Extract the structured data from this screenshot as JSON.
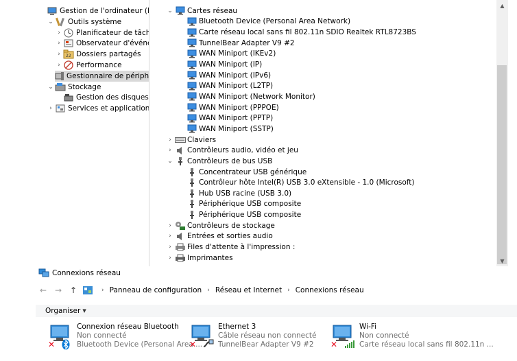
{
  "left_tree": [
    {
      "label": "Gestion de l'ordinateur (local)",
      "icon": "computer-management-icon",
      "chevron": "",
      "indent": 0,
      "selected": false
    },
    {
      "label": "Outils système",
      "icon": "system-tools-icon",
      "chevron": "down",
      "indent": 1,
      "selected": false
    },
    {
      "label": "Planificateur de tâches",
      "icon": "clock-icon",
      "chevron": "right",
      "indent": 2,
      "selected": false
    },
    {
      "label": "Observateur d'événeme",
      "icon": "event-viewer-icon",
      "chevron": "right",
      "indent": 2,
      "selected": false
    },
    {
      "label": "Dossiers partagés",
      "icon": "shared-folder-icon",
      "chevron": "right",
      "indent": 2,
      "selected": false
    },
    {
      "label": "Performance",
      "icon": "performance-icon",
      "chevron": "right",
      "indent": 2,
      "selected": false
    },
    {
      "label": "Gestionnaire de périphé",
      "icon": "device-manager-icon",
      "chevron": "",
      "indent": 2,
      "selected": true
    },
    {
      "label": "Stockage",
      "icon": "storage-icon",
      "chevron": "down",
      "indent": 1,
      "selected": false
    },
    {
      "label": "Gestion des disques",
      "icon": "disk-management-icon",
      "chevron": "",
      "indent": 2,
      "selected": false
    },
    {
      "label": "Services et applications",
      "icon": "services-icon",
      "chevron": "right",
      "indent": 1,
      "selected": false
    }
  ],
  "device_tree": [
    {
      "label": "Cartes réseau",
      "icon": "network-adapter-icon",
      "chevron": "down",
      "indent": 0
    },
    {
      "label": "Bluetooth Device (Personal Area Network)",
      "icon": "network-adapter-icon",
      "chevron": "",
      "indent": 1
    },
    {
      "label": "Carte réseau local sans fil 802.11n SDIO Realtek RTL8723BS",
      "icon": "network-adapter-icon",
      "chevron": "",
      "indent": 1
    },
    {
      "label": "TunnelBear Adapter V9 #2",
      "icon": "network-adapter-icon",
      "chevron": "",
      "indent": 1
    },
    {
      "label": "WAN Miniport (IKEv2)",
      "icon": "network-adapter-icon",
      "chevron": "",
      "indent": 1
    },
    {
      "label": "WAN Miniport (IP)",
      "icon": "network-adapter-icon",
      "chevron": "",
      "indent": 1
    },
    {
      "label": "WAN Miniport (IPv6)",
      "icon": "network-adapter-icon",
      "chevron": "",
      "indent": 1
    },
    {
      "label": "WAN Miniport (L2TP)",
      "icon": "network-adapter-icon",
      "chevron": "",
      "indent": 1
    },
    {
      "label": "WAN Miniport (Network Monitor)",
      "icon": "network-adapter-icon",
      "chevron": "",
      "indent": 1
    },
    {
      "label": "WAN Miniport (PPPOE)",
      "icon": "network-adapter-icon",
      "chevron": "",
      "indent": 1
    },
    {
      "label": "WAN Miniport (PPTP)",
      "icon": "network-adapter-icon",
      "chevron": "",
      "indent": 1
    },
    {
      "label": "WAN Miniport (SSTP)",
      "icon": "network-adapter-icon",
      "chevron": "",
      "indent": 1
    },
    {
      "label": "Claviers",
      "icon": "keyboard-icon",
      "chevron": "right",
      "indent": 0
    },
    {
      "label": "Contrôleurs audio, vidéo et jeu",
      "icon": "audio-icon",
      "chevron": "right",
      "indent": 0
    },
    {
      "label": "Contrôleurs de bus USB",
      "icon": "usb-icon",
      "chevron": "down",
      "indent": 0
    },
    {
      "label": "Concentrateur USB générique",
      "icon": "usb-icon",
      "chevron": "",
      "indent": 1
    },
    {
      "label": "Contrôleur hôte Intel(R) USB 3.0 eXtensible - 1.0 (Microsoft)",
      "icon": "usb-icon",
      "chevron": "",
      "indent": 1
    },
    {
      "label": "Hub USB racine (USB 3.0)",
      "icon": "usb-icon",
      "chevron": "",
      "indent": 1
    },
    {
      "label": "Périphérique USB composite",
      "icon": "usb-icon",
      "chevron": "",
      "indent": 1
    },
    {
      "label": "Périphérique USB composite",
      "icon": "usb-icon",
      "chevron": "",
      "indent": 1
    },
    {
      "label": "Contrôleurs de stockage",
      "icon": "storage-controller-icon",
      "chevron": "right",
      "indent": 0
    },
    {
      "label": "Entrées et sorties audio",
      "icon": "audio-icon",
      "chevron": "right",
      "indent": 0
    },
    {
      "label": "Files d'attente à l'impression :",
      "icon": "print-queue-icon",
      "chevron": "right",
      "indent": 0
    },
    {
      "label": "Imprimantes",
      "icon": "printer-icon",
      "chevron": "right",
      "indent": 0
    }
  ],
  "network_window": {
    "title": "Connexions réseau",
    "nav": {
      "back": "←",
      "forward": "→",
      "up": "↑"
    },
    "breadcrumb": [
      "Panneau de configuration",
      "Réseau et Internet",
      "Connexions réseau"
    ],
    "toolbar": {
      "organize_label": "Organiser"
    },
    "connections": [
      {
        "name": "Connexion réseau Bluetooth",
        "status": "Non connecté",
        "device": "Bluetooth Device (Personal Area ...",
        "badge": "bluetooth-icon"
      },
      {
        "name": "Ethernet 3",
        "status": "Câble réseau non connecté",
        "device": "TunnelBear Adapter V9 #2",
        "badge": "ethernet-cable-icon"
      },
      {
        "name": "Wi-Fi",
        "status": "Non connecté",
        "device": "Carte réseau local sans fil 802.11n ...",
        "badge": "wifi-signal-icon"
      }
    ]
  },
  "colors": {
    "accent": "#0078d7",
    "selection": "#d9d9d9",
    "error": "#e81123",
    "muted_text": "#6d6d6d"
  }
}
